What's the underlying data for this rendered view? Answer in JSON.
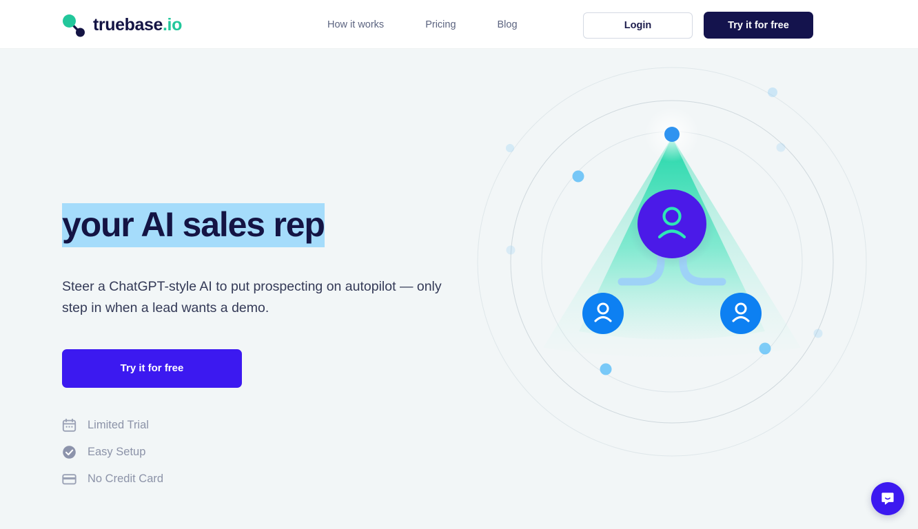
{
  "header": {
    "logo": {
      "name_main": "truebase",
      "name_suffix": ".io",
      "mark": "two-dot-network-icon",
      "mark_color_primary": "#22c79b",
      "mark_color_secondary": "#141444"
    },
    "nav": [
      {
        "label": "How it works"
      },
      {
        "label": "Pricing"
      },
      {
        "label": "Blog"
      }
    ],
    "login_label": "Login",
    "cta_label": "Try it for free",
    "cta_bg": "#14134d",
    "background": "#ffffff"
  },
  "hero": {
    "headline": "your AI sales rep",
    "headline_selected": true,
    "selection_color": "#a5dcfb",
    "subhead": "Steer a ChatGPT-style AI to put prospecting on autopilot — only step in when a lead wants a demo.",
    "cta_label": "Try it for free",
    "cta_bg": "#3c19f0",
    "background": "#f2f6f7",
    "features": [
      {
        "icon": "calendar-icon",
        "label": "Limited Trial"
      },
      {
        "icon": "check-circle-icon",
        "label": "Easy Setup"
      },
      {
        "icon": "credit-card-icon",
        "label": "No Credit Card"
      }
    ],
    "illustration": {
      "name": "ai-sales-rep-network-diagram",
      "center_node": {
        "icon": "person-icon",
        "fill": "#4b1ae8",
        "icon_color": "#2ee6b6"
      },
      "child_nodes": [
        {
          "icon": "person-icon",
          "fill": "#0d80f2",
          "icon_color": "#ffffff"
        },
        {
          "icon": "person-icon",
          "fill": "#0d80f2",
          "icon_color": "#ffffff"
        }
      ],
      "beam_color": "#2ee6b6",
      "connector_color": "#9ed2f7",
      "orbit_dot_color": "#6fc4f7"
    }
  },
  "chat": {
    "widget_label": "Open Intercom Messenger",
    "icon": "chat-bubble-smile-icon",
    "bg": "#3c19f0"
  }
}
